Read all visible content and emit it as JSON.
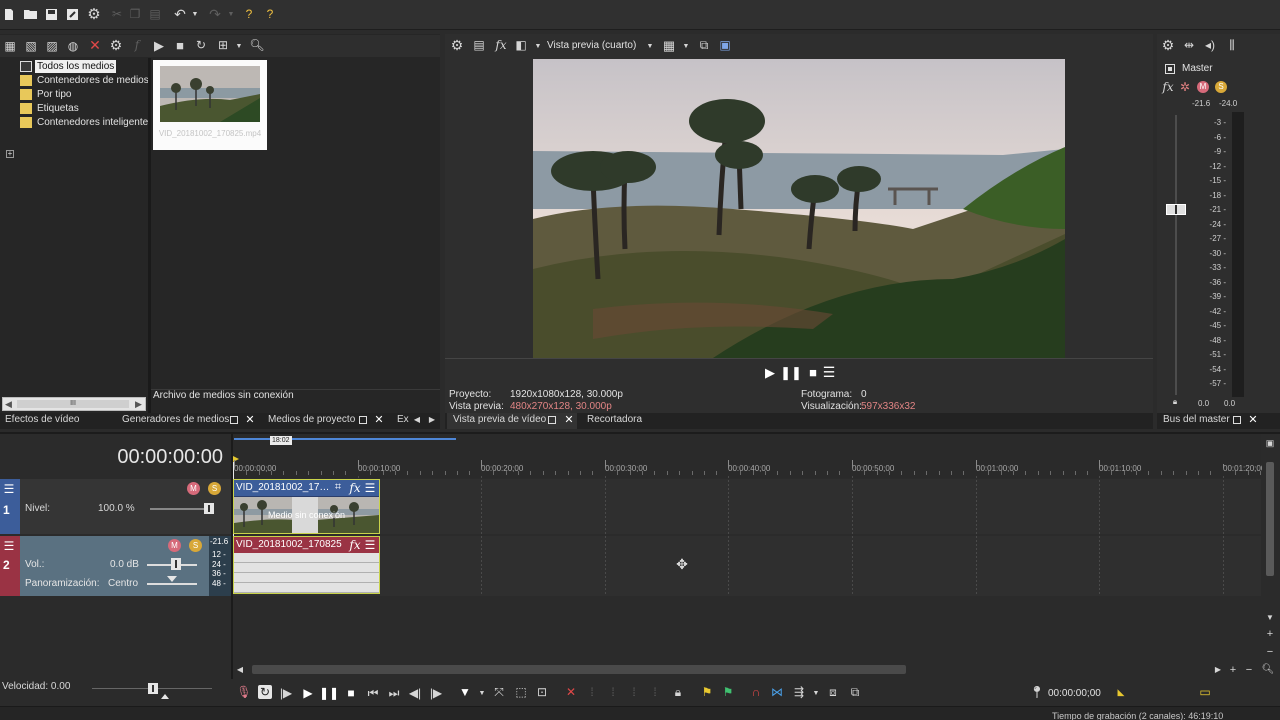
{
  "timecode": "00:00:00:00",
  "explorer": {
    "tree": [
      {
        "label": "Todos los medios"
      },
      {
        "label": "Contenedores de medios"
      },
      {
        "label": "Por tipo"
      },
      {
        "label": "Etiquetas"
      },
      {
        "label": "Contenedores inteligente"
      }
    ],
    "media_file": "VID_20181002_170825.mp4",
    "scroll_label": "III",
    "status": "Archivo de medios sin conexión"
  },
  "tabs_left": {
    "video_fx": "Efectos de vídeo",
    "media_generators": "Generadores de medios",
    "project_media": "Medios de proyecto",
    "explorer_short": "Ex"
  },
  "preview": {
    "quality": "Vista previa (cuarto)",
    "project_label": "Proyecto:",
    "project_value": "1920x1080x128, 30.000p",
    "preview_label": "Vista previa:",
    "preview_value": "480x270x128, 30.000p",
    "frame_label": "Fotograma:",
    "frame_value": "0",
    "display_label": "Visualización:",
    "display_value": "597x336x32",
    "tab_preview": "Vista previa de vídeo",
    "tab_trimmer": "Recortadora"
  },
  "master": {
    "title": "Master",
    "peak_left": "-21.6",
    "peak_right": "-24.0",
    "scale": [
      "3",
      "6",
      "9",
      "12",
      "15",
      "18",
      "21",
      "24",
      "27",
      "30",
      "33",
      "36",
      "39",
      "42",
      "45",
      "48",
      "51",
      "54",
      "57"
    ],
    "bottom_left": "0.0",
    "bottom_right": "0.0",
    "tab": "Bus del master"
  },
  "tracks": {
    "video": {
      "number": "1",
      "level_label": "Nivel:",
      "level_value": "100.0 %",
      "clip_name": "VID_20181002_17…",
      "offline_text": "Medio sin conexión"
    },
    "audio": {
      "number": "2",
      "vol_label": "Vol.:",
      "vol_value": "0.0 dB",
      "pan_label": "Panoramización:",
      "pan_value": "Centro",
      "clip_name": "VID_20181002_170825",
      "meter_top": "-21.6",
      "meter_scale": [
        "12",
        "24",
        "36",
        "48"
      ]
    }
  },
  "ruler": {
    "loop_label": "18:02",
    "ticks": [
      "00:00:00;00",
      "00:00:10;00",
      "00:00:20;00",
      "00:00:30;00",
      "00:00:40;00",
      "00:00:50;00",
      "00:01:00;00",
      "00:01:10;00",
      "00:01:20;00"
    ]
  },
  "transport": {
    "speed": "Velocidad: 0.00",
    "timecode": "00:00:00;00",
    "record_time": "Tiempo de grabación (2 canales): 46:19:10"
  },
  "icons": [
    "new-icon",
    "open-icon",
    "save-icon",
    "save-as-icon",
    "settings-icon",
    "undo-icon",
    "redo-icon",
    "help-icon",
    "play-icon",
    "pause-icon",
    "stop-icon",
    "menu-icon",
    "grid-icon",
    "fx-icon",
    "close-icon",
    "folder-icon"
  ],
  "colors": {
    "video_track": "#3c5d9a",
    "audio_track": "#9a3344",
    "clip_border": "#c9d34a",
    "accent_value": "#e28585"
  }
}
